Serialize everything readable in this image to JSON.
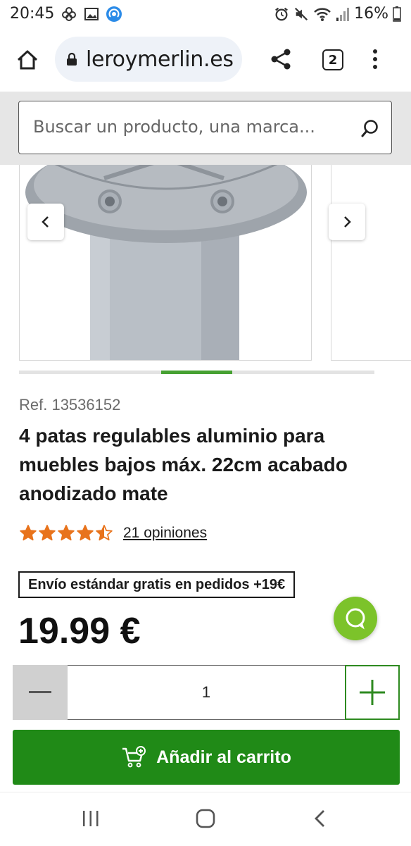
{
  "status_bar": {
    "time": "20:45",
    "left_icons": [
      "flower-icon",
      "gallery-icon",
      "hotspot-icon"
    ],
    "right_icons": [
      "alarm-icon",
      "mute-icon",
      "wifi-icon",
      "signal-icon"
    ],
    "battery": "16%"
  },
  "browser": {
    "url": "leroymerlin.es",
    "tab_count": "2"
  },
  "search": {
    "placeholder": "Buscar un producto, una marca..."
  },
  "carousel": {
    "slide_index": 3,
    "slide_count": 5
  },
  "product": {
    "ref": "Ref. 13536152",
    "title": "4 patas regulables aluminio para muebles bajos máx. 22cm acabado anodizado mate",
    "rating": 4.5,
    "reviews_link": "21 opiniones",
    "shipping_badge": "Envío estándar gratis en pedidos +19€",
    "price": "19.99 €"
  },
  "quantity": {
    "value": "1"
  },
  "cart": {
    "label": "Añadir al carrito"
  },
  "colors": {
    "accent_green": "#208a17",
    "star_orange": "#e8731c",
    "chat_green": "#7cc32a"
  }
}
